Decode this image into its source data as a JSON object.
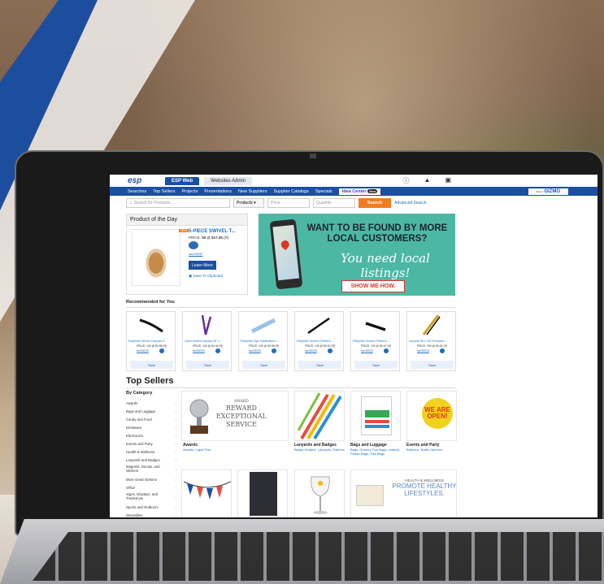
{
  "app": {
    "logo": "esp"
  },
  "tabs": [
    {
      "label": "ESP Web",
      "active": true
    },
    {
      "label": "Websites Admin",
      "active": false
    }
  ],
  "top_icons": [
    "help-icon",
    "bell-icon",
    "clipboard-icon"
  ],
  "nav": {
    "items": [
      "Searches",
      "Top Sellers",
      "Projects",
      "Presentations",
      "New Suppliers",
      "Supplier Catalogs",
      "Specials"
    ],
    "idea_center": "Idea Center",
    "idea_badge": "New",
    "gizmo": "GIZMO",
    "gizmo_prefix": "Brand"
  },
  "search": {
    "placeholder": "Search for Products...",
    "type": "Products",
    "price_placeholder": "Price",
    "quantity_placeholder": "Quantity",
    "button": "Search",
    "advanced": "Advanced Search"
  },
  "product_of_day": {
    "title": "Product of the Day",
    "badge": "NEW",
    "name": "5-PIECE SWIVEL T...",
    "price_prefix": "PRICE:",
    "price": "50 @ $17.45",
    "price_suffix": "(R)",
    "id": "asi/30940",
    "learn_more": "Learn More",
    "save": "Save To Clipboard"
  },
  "banner": {
    "headline": "WANT TO BE FOUND BY MORE LOCAL CUSTOMERS?",
    "script": "You need local listings!",
    "cta": "SHOW ME HOW."
  },
  "recommended": {
    "label": "Recommended for You",
    "save": "Save",
    "items": [
      {
        "name": "Polyester Woven Lanyard 3...",
        "price": "PRICE: 100 @ $0.88 (R)",
        "id": "asi/38028"
      },
      {
        "name": "Open Ended Lanyard 36\" x ...",
        "price": "PRICE: 100 @ $0.44 (R)",
        "id": "asi/38028"
      },
      {
        "name": "Polyester Dye Sublimated L...",
        "price": "PRICE: 100 @ $0.58 (R)",
        "id": "asi/38028"
      },
      {
        "name": "Polyester Screen Printed L...",
        "price": "PRICE: 100 @ $0.62 (R)",
        "id": "asi/38028"
      },
      {
        "name": "Polyester Screen Printed L...",
        "price": "PRICE: 100 @ $0.67 (R)",
        "id": "asi/38028"
      },
      {
        "name": "Lanyard 36 x 3/4\" Premium...",
        "price": "PRICE: 250 @ $0.81 (R)",
        "id": "asi/38028"
      }
    ]
  },
  "top_sellers": {
    "title": "Top Sellers",
    "by_category": "By Category",
    "categories": [
      "Awards",
      "Bags and Luggage",
      "Candy and Food",
      "Drinkware",
      "Electronics",
      "Events and Party",
      "Health & Wellness",
      "Lanyards and Badges",
      "Magnets, Decals, and Stickers",
      "More Great Options",
      "Office",
      "Signs, Displays, and Tradeshow",
      "Sports and Outdoors",
      "Wearables"
    ],
    "tiles": [
      {
        "caption": "Awards",
        "sub": "Awards, Lapel Pins",
        "art_top": "AWARD",
        "art_main": "REWARD EXCEPTIONAL SERVICE"
      },
      {
        "caption": "Lanyards and Badges",
        "sub": "Badge Holders, Lanyards, Patches"
      },
      {
        "caption": "Bags and Luggage",
        "sub": "Bags, Grocery Tote Bags, Leather, Plastic Bags, Tote Bags"
      },
      {
        "caption": "Events and Party",
        "sub": "Balloons, Bottle Openers",
        "art": "WE ARE OPEN!"
      }
    ],
    "health_tile": {
      "art_top": "HEALTH & WELLNESS",
      "art_main": "PROMOTE HEALTHY LIFESTYLES."
    }
  }
}
